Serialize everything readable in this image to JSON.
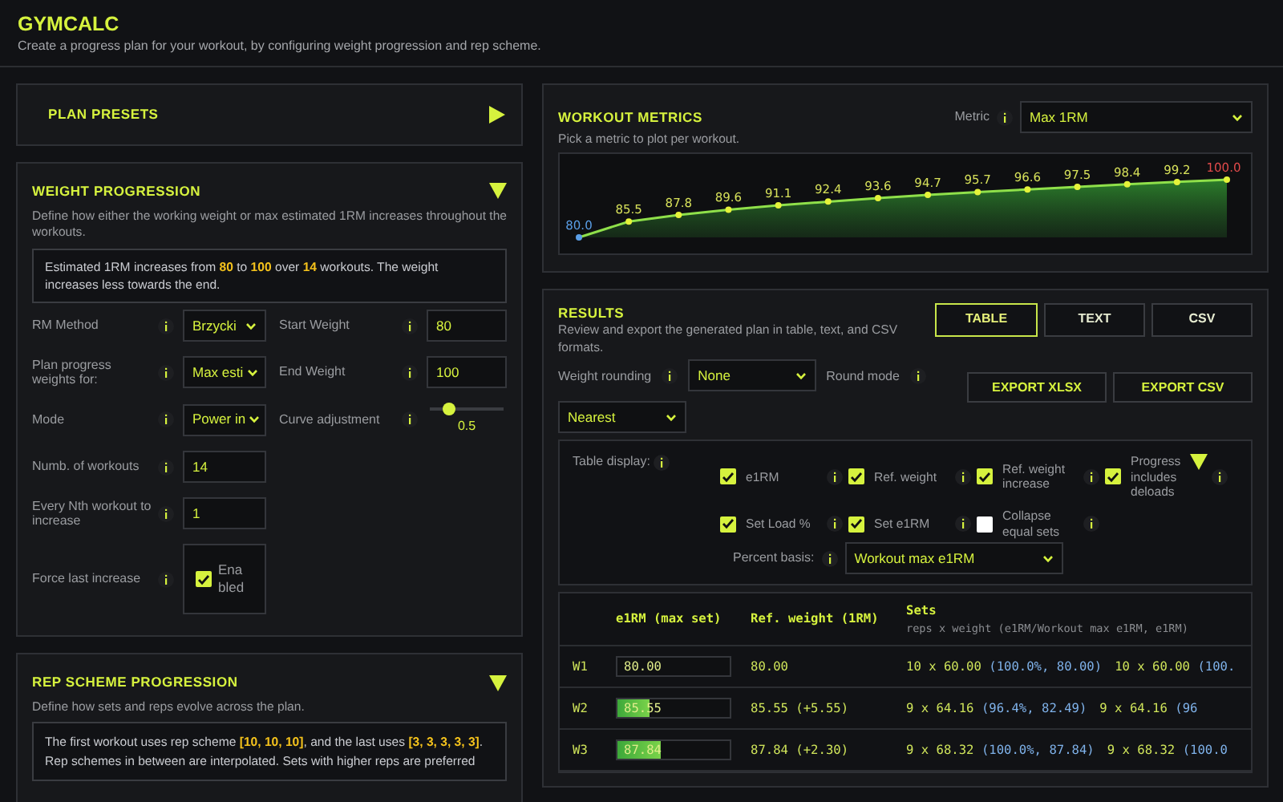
{
  "app": {
    "title": "GYMCALC",
    "subtitle": "Create a progress plan for your workout, by configuring weight progression and rep scheme."
  },
  "plan_presets": {
    "title": "PLAN PRESETS",
    "expanded": false
  },
  "weight_progression": {
    "title": "WEIGHT PROGRESSION",
    "expanded": true,
    "description": "Define how either the working weight or max estimated 1RM increases throughout the workouts.",
    "summary": "Estimated 1RM increases from **80** to **100** over **14** workouts. The weight increases less towards the end.",
    "fields_left": [
      {
        "kind": "select",
        "label": "RM Method",
        "value": "Brzycki"
      },
      {
        "kind": "select",
        "label": "Plan progress weights for:",
        "value": "Max esti"
      },
      {
        "kind": "select",
        "label": "Mode",
        "value": "Power in"
      },
      {
        "kind": "input",
        "label": "Numb. of workouts",
        "value": "14"
      },
      {
        "kind": "input",
        "label": "Every Nth workout to increase",
        "value": "1"
      },
      {
        "kind": "checkbox",
        "label": "Force last increase",
        "value": "Enabled",
        "checked": true
      }
    ],
    "fields_right": [
      {
        "kind": "input",
        "label": "Start Weight",
        "value": "80"
      },
      {
        "kind": "input",
        "label": "End Weight",
        "value": "100"
      },
      {
        "kind": "slider",
        "label": "Curve adjustment",
        "value": "0.5",
        "level": 0.26
      }
    ]
  },
  "rep_scheme": {
    "title": "REP SCHEME PROGRESSION",
    "expanded": true,
    "description": "Define how sets and reps evolve across the plan.",
    "summary": "The first workout uses rep scheme **[10, 10, 10]**, and the last uses **[3, 3, 3, 3, 3]**. Rep schemes in between are interpolated. Sets with higher reps are preferred"
  },
  "workout_metrics": {
    "title": "WORKOUT METRICS",
    "description": "Pick a metric to plot per workout.",
    "metric": {
      "label": "Metric",
      "value": "Max 1RM"
    },
    "plot": {
      "point_labels": [
        "80.0",
        "85.5",
        "87.8",
        "89.6",
        "91.1",
        "92.4",
        "93.6",
        "94.7",
        "95.7",
        "96.6",
        "97.5",
        "98.4",
        "99.2",
        "100.0"
      ]
    }
  },
  "results": {
    "title": "RESULTS",
    "description": "Review and export the generated plan in table, text, and CSV formats.",
    "views": [
      {
        "label": "TABLE",
        "selected": true
      },
      {
        "label": "TEXT",
        "selected": false
      },
      {
        "label": "CSV",
        "selected": false
      }
    ],
    "weight_rounding": {
      "label": "Weight rounding",
      "value": "None"
    },
    "round_mode": {
      "label": "Round mode",
      "value": "Nearest"
    },
    "exports": [
      "EXPORT XLSX",
      "EXPORT CSV"
    ],
    "table_display": {
      "label": "Table display:",
      "options": [
        {
          "label": "e1RM",
          "checked": true,
          "menu": false
        },
        {
          "label": "Ref. weight",
          "checked": true,
          "menu": false
        },
        {
          "label": "Ref. weight increase",
          "checked": true,
          "menu": false
        },
        {
          "label": "Progress includes deloads",
          "checked": true,
          "menu": true
        },
        {
          "label": "Set Load %",
          "checked": true,
          "menu": false
        },
        {
          "label": "Set e1RM",
          "checked": true,
          "menu": false
        },
        {
          "label": "Collapse equal sets",
          "checked": false,
          "menu": false
        }
      ],
      "percent_basis": {
        "label": "Percent basis:",
        "value": "Workout max e1RM"
      }
    },
    "table": {
      "columns": [
        "e1RM (max set)",
        "Ref. weight (1RM)",
        "Sets"
      ],
      "sets_note": "reps x weight (e1RM/Workout max e1RM, e1RM)",
      "rows": [
        {
          "workout": "W1",
          "e1rm": "80.00",
          "level": 0,
          "ref": "80.00",
          "sets": [
            {
              "set": "10 x 60.00",
              "detail": "(100.0%, 80.00)"
            },
            {
              "set": "10 x 60.00",
              "detail": "(100."
            }
          ]
        },
        {
          "workout": "W2",
          "e1rm": "85.55",
          "level": 0.28,
          "ref": "85.55 (+5.55)",
          "sets": [
            {
              "set": "9 x 64.16",
              "detail": "(96.4%, 82.49)"
            },
            {
              "set": "9 x 64.16",
              "detail": "(96"
            }
          ]
        },
        {
          "workout": "W3",
          "e1rm": "87.84",
          "level": 0.39,
          "ref": "87.84 (+2.30)",
          "sets": [
            {
              "set": "9 x 68.32",
              "detail": "(100.0%, 87.84)"
            },
            {
              "set": "9 x 68.32",
              "detail": "(100.0"
            }
          ]
        }
      ]
    }
  }
}
